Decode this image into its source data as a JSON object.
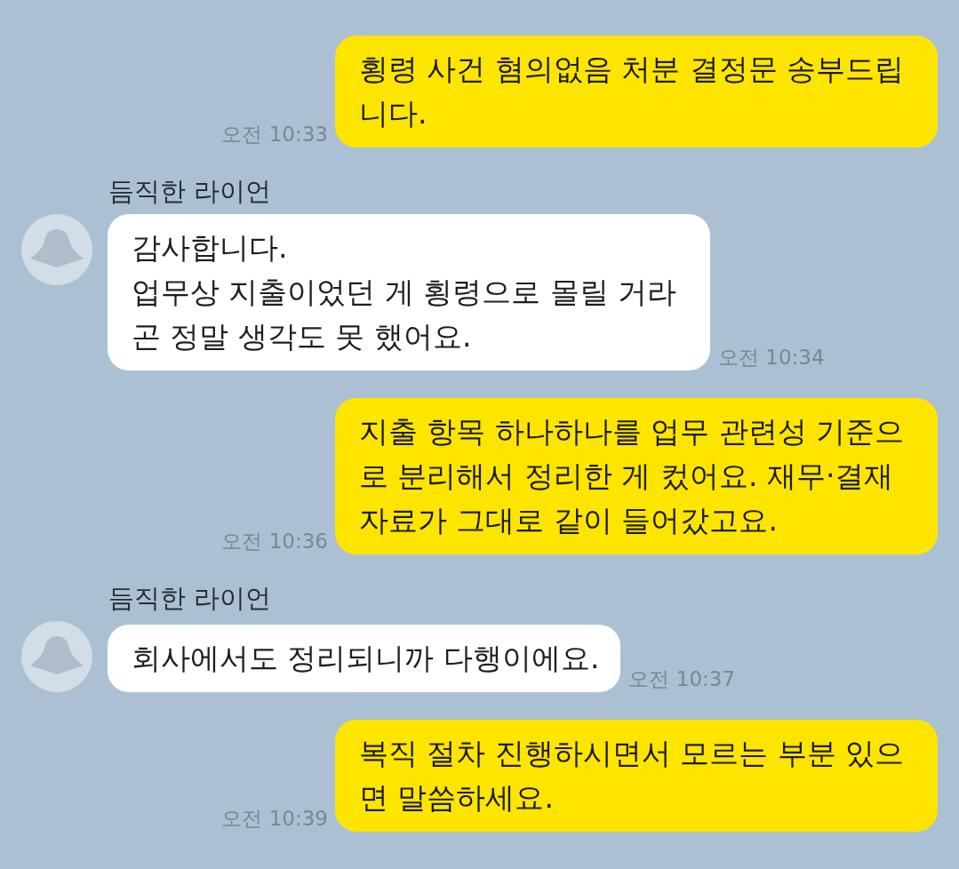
{
  "messages": [
    {
      "kind": "outgoing",
      "text": "횡령 사건 혐의없음 처분 결정문 송부드립니다.",
      "time": "오전 10:33"
    },
    {
      "kind": "incoming",
      "sender": "듬직한 라이언",
      "text": "감사합니다.\n업무상 지출이었던 게 횡령으로 몰릴 거라곤 정말 생각도 못 했어요.",
      "time": "오전 10:34"
    },
    {
      "kind": "outgoing",
      "text": "지출 항목 하나하나를 업무 관련성 기준으로 분리해서 정리한 게 컸어요. 재무·결재 자료가 그대로 같이 들어갔고요.",
      "time": "오전 10:36"
    },
    {
      "kind": "incoming",
      "sender": "듬직한 라이언",
      "text": "회사에서도 정리되니까 다행이에요.",
      "time": "오전 10:37"
    },
    {
      "kind": "outgoing",
      "text": "복직 절차 진행하시면서 모르는 부분 있으면 말씀하세요.",
      "time": "오전 10:39"
    }
  ]
}
